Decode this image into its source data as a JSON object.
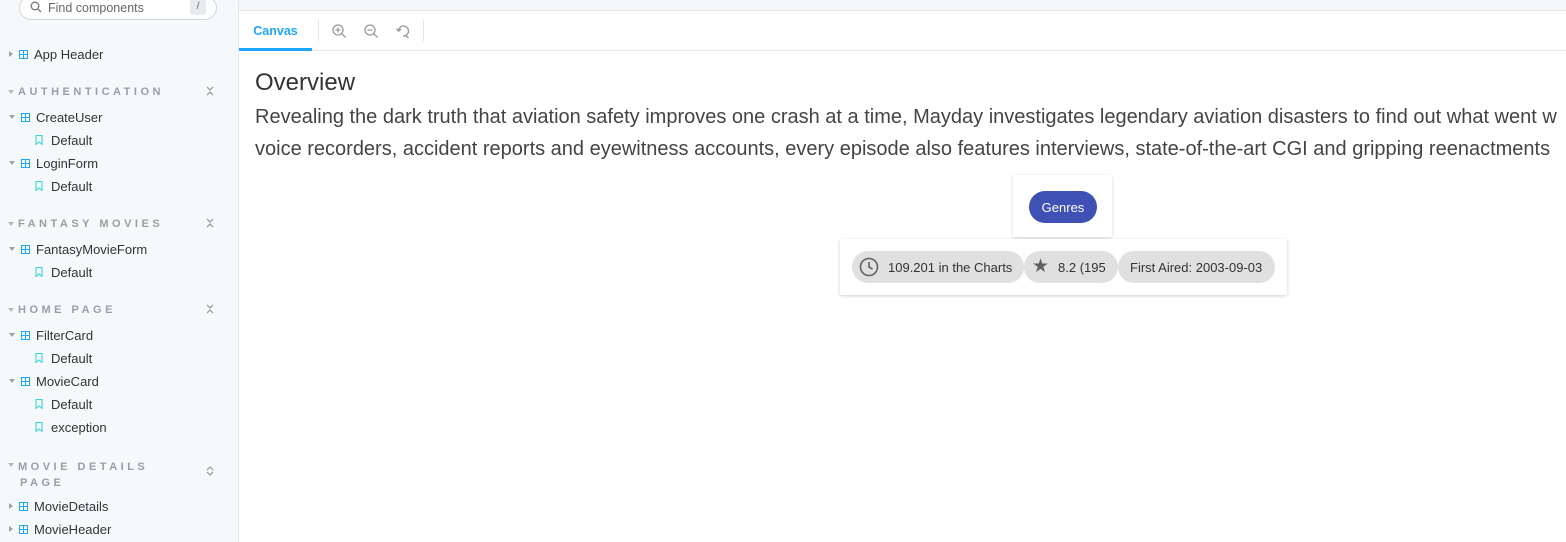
{
  "search": {
    "placeholder": "Find components",
    "shortcut": "/"
  },
  "sidebar": {
    "items": [
      {
        "label": "App Header"
      },
      {
        "section": "AUTHENTICATION"
      },
      {
        "label": "CreateUser"
      },
      {
        "label": "Default"
      },
      {
        "label": "LoginForm"
      },
      {
        "label": "Default"
      },
      {
        "section": "FANTASY MOVIES"
      },
      {
        "label": "FantasyMovieForm"
      },
      {
        "label": "Default"
      },
      {
        "section": "HOME PAGE"
      },
      {
        "label": "FilterCard"
      },
      {
        "label": "Default"
      },
      {
        "label": "MovieCard"
      },
      {
        "label": "Default"
      },
      {
        "label": "exception"
      },
      {
        "section": "MOVIE DETAILS",
        "section2": "PAGE"
      },
      {
        "label": "MovieDetails"
      },
      {
        "label": "MovieHeader"
      }
    ]
  },
  "toolbar": {
    "tab_canvas": "Canvas"
  },
  "main": {
    "overview_title": "Overview",
    "overview_line1": "Revealing the dark truth that aviation safety improves one crash at a time, Mayday investigates legendary aviation disasters to find out what went w",
    "overview_line2": "voice recorders, accident reports and eyewitness accounts, every episode also features interviews, state-of-the-art CGI and gripping reenactments",
    "genres_label": "Genres",
    "chips": {
      "popularity": "109.201 in the Charts",
      "rating": "8.2 (195",
      "first_aired": "First Aired: 2003-09-03"
    }
  },
  "colors": {
    "accent": "#1ea7fd",
    "genres_button": "#3f51b5",
    "chip_bg": "#e0e0e0"
  }
}
